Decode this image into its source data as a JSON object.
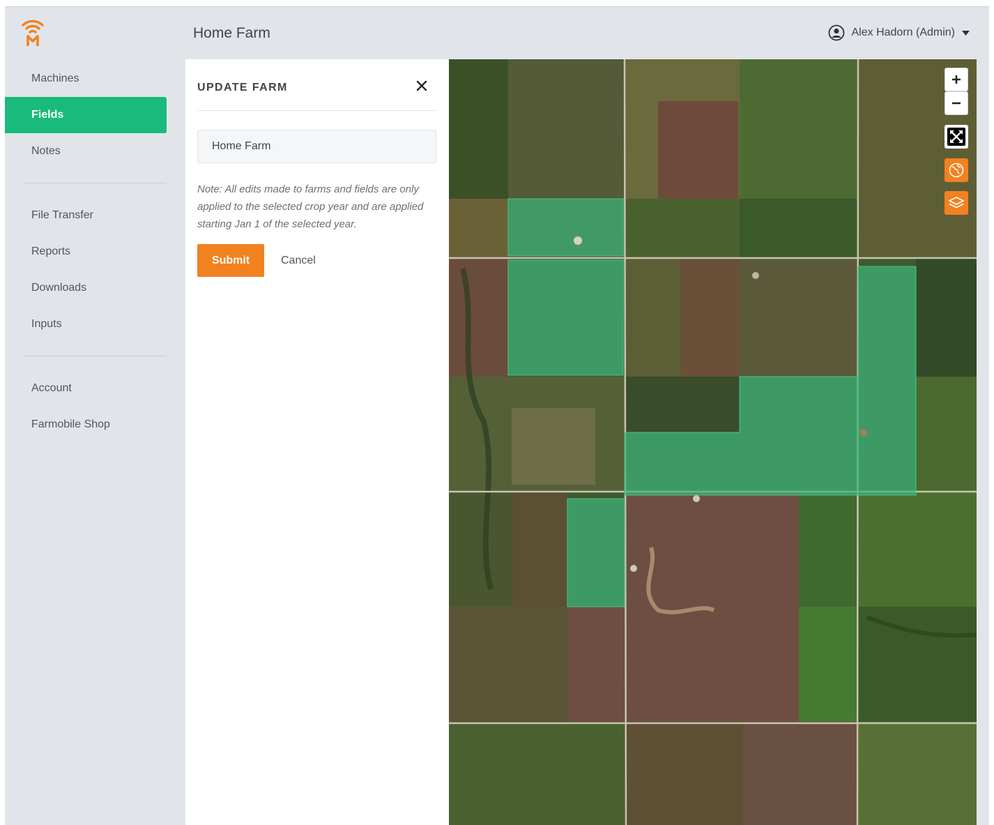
{
  "header": {
    "title": "Home Farm",
    "user_name": "Alex Hadorn (Admin)"
  },
  "sidebar": {
    "groups": [
      [
        {
          "label": "Machines",
          "active": false
        },
        {
          "label": "Fields",
          "active": true
        },
        {
          "label": "Notes",
          "active": false
        }
      ],
      [
        {
          "label": "File Transfer",
          "active": false
        },
        {
          "label": "Reports",
          "active": false
        },
        {
          "label": "Downloads",
          "active": false
        },
        {
          "label": "Inputs",
          "active": false
        }
      ],
      [
        {
          "label": "Account",
          "active": false
        },
        {
          "label": "Farmobile Shop",
          "active": false
        }
      ]
    ]
  },
  "panel": {
    "title": "UPDATE FARM",
    "farm_name_value": "Home Farm",
    "note": "Note: All edits made to farms and fields are only applied to the selected crop year and are applied starting Jan 1 of the selected year.",
    "submit_label": "Submit",
    "cancel_label": "Cancel"
  },
  "map": {
    "controls": [
      {
        "name": "zoom-in-button",
        "icon": "plus-icon",
        "style": "white"
      },
      {
        "name": "zoom-out-button",
        "icon": "minus-icon",
        "style": "white"
      },
      {
        "name": "fullscreen-button",
        "icon": "expand-arrows-icon",
        "style": "black"
      },
      {
        "name": "basemap-button",
        "icon": "globe-icon",
        "style": "orange"
      },
      {
        "name": "layers-button",
        "icon": "layers-icon",
        "style": "orange"
      }
    ]
  },
  "colors": {
    "brand_orange": "#f28120",
    "active_green": "#19ba7c",
    "field_highlight": "#3fb37a",
    "sidebar_bg": "#e1e5ea"
  }
}
